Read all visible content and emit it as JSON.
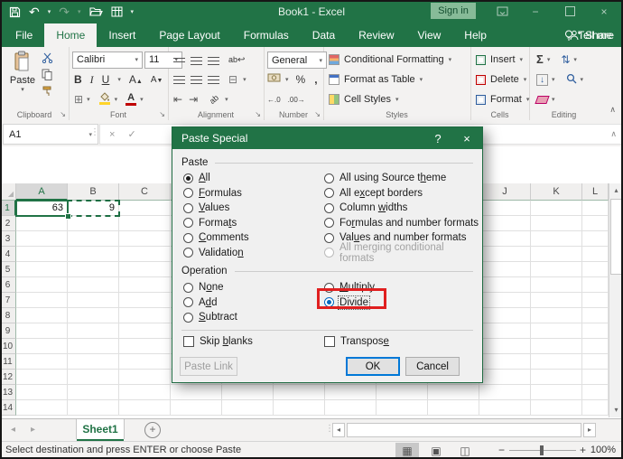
{
  "titlebar": {
    "title": "Book1 - Excel",
    "sign_in": "Sign in"
  },
  "ribbon": {
    "tabs": [
      {
        "label": "File",
        "file": true
      },
      {
        "label": "Home",
        "active": true
      },
      {
        "label": "Insert"
      },
      {
        "label": "Page Layout"
      },
      {
        "label": "Formulas"
      },
      {
        "label": "Data"
      },
      {
        "label": "Review"
      },
      {
        "label": "View"
      },
      {
        "label": "Help"
      }
    ],
    "tell_me": "Tell me",
    "share": "Share",
    "clipboard": {
      "label": "Clipboard",
      "paste": "Paste"
    },
    "font": {
      "label": "Font",
      "name": "Calibri",
      "size": "11",
      "bold": "B",
      "italic": "I",
      "underline": "U"
    },
    "alignment": {
      "label": "Alignment"
    },
    "number": {
      "label": "Number",
      "format": "General",
      "percent": "%",
      "comma": ","
    },
    "styles": {
      "label": "Styles",
      "items": [
        "Conditional Formatting",
        "Format as Table",
        "Cell Styles"
      ]
    },
    "cells": {
      "label": "Cells",
      "items": [
        "Insert",
        "Delete",
        "Format"
      ]
    },
    "editing": {
      "label": "Editing"
    }
  },
  "formula_bar": {
    "name_box": "A1"
  },
  "grid": {
    "columns": [
      "A",
      "B",
      "C",
      "D",
      "E",
      "F",
      "G",
      "H",
      "I",
      "J",
      "K",
      "L"
    ],
    "row_count": 14,
    "cells": {
      "A1": "63",
      "B1": "9"
    },
    "selected_cell": "A1",
    "copied_cell": "B1"
  },
  "dialog": {
    "title": "Paste Special",
    "help": "?",
    "paste": {
      "label": "Paste",
      "left": [
        {
          "t": "All",
          "u": 0,
          "sel": true
        },
        {
          "t": "Formulas",
          "u": 0
        },
        {
          "t": "Values",
          "u": 0
        },
        {
          "t": "Formats",
          "u": 5
        },
        {
          "t": "Comments",
          "u": 0
        },
        {
          "t": "Validation",
          "u": 9
        }
      ],
      "right": [
        {
          "t": "All using Source theme",
          "u": 18
        },
        {
          "t": "All except borders",
          "u": 5
        },
        {
          "t": "Column widths",
          "u": 7
        },
        {
          "t": "Formulas and number formats",
          "u": 2
        },
        {
          "t": "Values and number formats",
          "u": 3
        },
        {
          "t": "All merging conditional formats",
          "u": -1,
          "dis": true
        }
      ]
    },
    "operation": {
      "label": "Operation",
      "left": [
        {
          "t": "None",
          "u": 1
        },
        {
          "t": "Add",
          "u": 1
        },
        {
          "t": "Subtract",
          "u": 0
        }
      ],
      "right": [
        {
          "t": "Multiply",
          "u": 0
        },
        {
          "t": "Divide",
          "u": 1,
          "sel": true,
          "blue": true,
          "focus": true
        }
      ]
    },
    "skip_blanks": {
      "t": "Skip blanks",
      "u": 5
    },
    "transpose": {
      "t": "Transpose",
      "u": 8
    },
    "buttons": {
      "paste_link": "Paste Link",
      "ok": "OK",
      "cancel": "Cancel"
    }
  },
  "sheet_bar": {
    "active_sheet": "Sheet1"
  },
  "status_bar": {
    "message": "Select destination and press ENTER or choose Paste",
    "zoom_level": "100%"
  },
  "colors": {
    "excel_green": "#217346",
    "annotation_red": "#e01f1f",
    "focus_blue": "#0078d7",
    "font_red": "#c00000",
    "fill_yellow": "#ffd42a"
  },
  "icons": {
    "caret": "▾",
    "sigma": "Σ",
    "undo": "↶",
    "redo": "↷",
    "wrap_return": "↩",
    "ab": "ab",
    "indent_dec": "⇤",
    "indent_inc": "⇥",
    "fill_down": "↓",
    "sort": "⇅",
    "borders": "⊞",
    "merge": "⊟",
    "grow_font": "A",
    "shrink_font": "A",
    "font_color": "A",
    "chevron_up": "∧",
    "scroll_left": "◂",
    "scroll_right": "▸",
    "scroll_up": "▴",
    "scroll_down": "▾",
    "add_sheet": "+",
    "minus": "−",
    "plus": "+",
    "select_all_corner": "◢",
    "dialog_launcher": "↘",
    "ellipsis_v": "⋮",
    "check": "✓",
    "cross": "×",
    "help": "?",
    "view_normal": "▦",
    "view_layout": "▣",
    "view_break": "◫",
    "inc_decimal": "←.0",
    "dec_decimal": ".00→",
    "percent": "%",
    "comma": ","
  }
}
